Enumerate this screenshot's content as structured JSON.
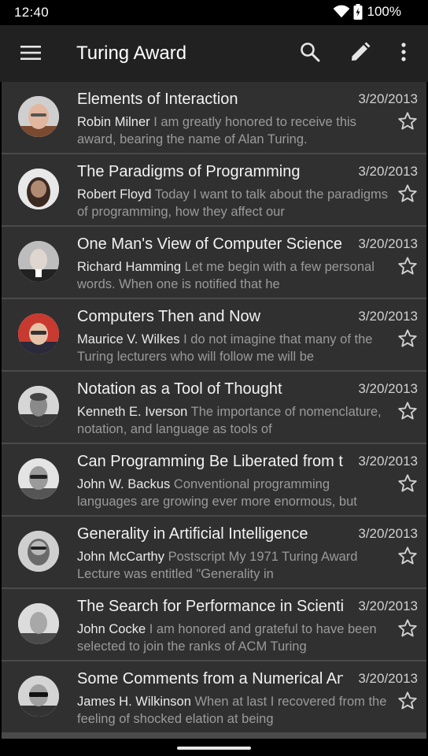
{
  "status_bar": {
    "time": "12:40",
    "battery": "100%"
  },
  "app_bar": {
    "title": "Turing Award",
    "menu_icon": "menu-icon",
    "actions": [
      "search-icon",
      "edit-icon",
      "more-vert-icon"
    ]
  },
  "colors": {
    "app_bar_bg": "#212121",
    "list_bg": "#303030",
    "divider": "#4a4a4a",
    "author_text": "#eaeaea",
    "preview_text": "#9a9a9a"
  },
  "items": [
    {
      "title": "Elements of Interaction",
      "date": "3/20/2013",
      "author": "Robin Milner",
      "preview": "I am greatly honored to receive this award, bearing the name of Alan Turing."
    },
    {
      "title": "The Paradigms of Programming",
      "date": "3/20/2013",
      "author": "Robert Floyd",
      "preview": "Today I want to talk about the paradigms of programming, how they affect our"
    },
    {
      "title": "One Man's View of Computer Science",
      "date": "3/20/2013",
      "author": "Richard Hamming",
      "preview": "Let me begin with a few personal words. When one is notified that he"
    },
    {
      "title": "Computers Then and Now",
      "date": "3/20/2013",
      "author": "Maurice V. Wilkes",
      "preview": "I do not imagine that many of the Turing lecturers who will follow me will be"
    },
    {
      "title": "Notation as a Tool of Thought",
      "date": "3/20/2013",
      "author": "Kenneth E. Iverson",
      "preview": "The importance of nomenclature, notation, and language as tools of"
    },
    {
      "title": "Can Programming Be Liberated from the von Neumann Style?",
      "date": "3/20/2013",
      "author": "John W. Backus",
      "preview": "Conventional programming languages are growing ever more enormous, but"
    },
    {
      "title": "Generality in Artificial Intelligence",
      "date": "3/20/2013",
      "author": "John McCarthy",
      "preview": "Postscript My 1971 Turing Award Lecture was entitled \"Generality in"
    },
    {
      "title": "The Search for Performance in Scientific Processors",
      "date": "3/20/2013",
      "author": "John Cocke",
      "preview": "I am honored and grateful to have been selected to join the ranks of ACM Turing"
    },
    {
      "title": "Some Comments from a Numerical Analyst",
      "date": "3/20/2013",
      "author": "James H. Wilkinson",
      "preview": "When at last I recovered from the feeling of shocked elation at being"
    }
  ]
}
